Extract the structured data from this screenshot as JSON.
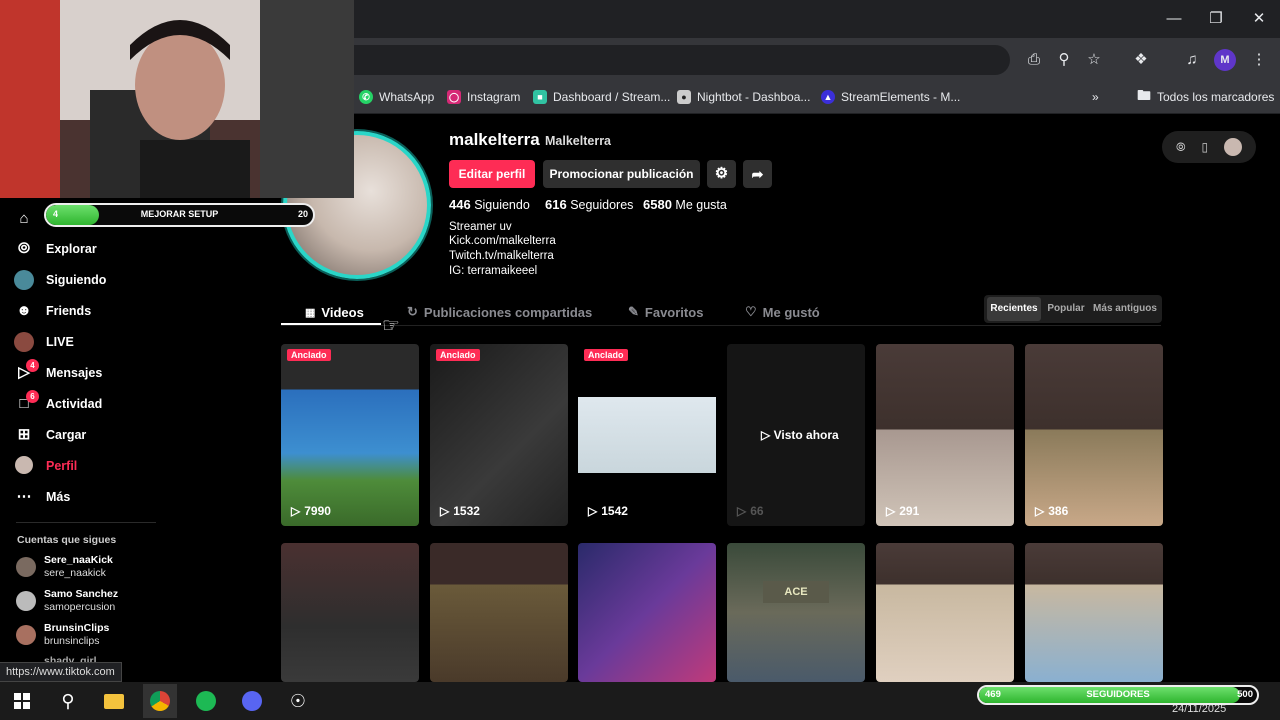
{
  "browser": {
    "bookmarks": [
      {
        "label": "WhatsApp",
        "icon": "whatsapp-icon",
        "color": "#25d366"
      },
      {
        "label": "Instagram",
        "icon": "instagram-icon",
        "color": "#d62976"
      },
      {
        "label": "Dashboard / Stream...",
        "icon": "streamlabs-icon",
        "color": "#31c3a2"
      },
      {
        "label": "Nightbot - Dashboa...",
        "icon": "nightbot-icon",
        "color": "#cccccc"
      },
      {
        "label": "StreamElements - M...",
        "icon": "streamelements-icon",
        "color": "#3b2fd9"
      }
    ],
    "all_bookmarks": "Todos los marcadores",
    "profile_initial": "M",
    "status_url": "https://www.tiktok.com"
  },
  "overlay": {
    "setup": {
      "label": "MEJORAR SETUP",
      "current": "4",
      "goal": "20",
      "progress": 0.2
    },
    "followers": {
      "label": "SEGUIDORES",
      "current": "469",
      "goal": "500",
      "progress": 0.938
    }
  },
  "sidebar": {
    "items": [
      {
        "label": "",
        "icon": "home-icon"
      },
      {
        "label": "Explorar",
        "icon": "compass-icon"
      },
      {
        "label": "Siguiendo",
        "icon": "following-icon"
      },
      {
        "label": "Friends",
        "icon": "friends-icon"
      },
      {
        "label": "LIVE",
        "icon": "live-icon"
      },
      {
        "label": "Mensajes",
        "icon": "messages-icon",
        "badge": "4"
      },
      {
        "label": "Actividad",
        "icon": "activity-icon",
        "badge": "6"
      },
      {
        "label": "Cargar",
        "icon": "upload-icon"
      },
      {
        "label": "Perfil",
        "icon": "profile-icon"
      },
      {
        "label": "Más",
        "icon": "more-icon"
      }
    ],
    "following_header": "Cuentas que sigues",
    "accounts": [
      {
        "name": "Sere_naaKick",
        "user": "sere_naakick"
      },
      {
        "name": "Samo Sanchez",
        "user": "samopercusion"
      },
      {
        "name": "BrunsinClips",
        "user": "brunsinclips"
      },
      {
        "name": "shady_girl",
        "user": ""
      }
    ]
  },
  "profile": {
    "username": "malkelterra",
    "display_name": "Malkelterra",
    "edit_button": "Editar perfil",
    "promote_button": "Promocionar publicación",
    "stats": {
      "following": "446",
      "following_label": "Siguiendo",
      "followers": "616",
      "followers_label": "Seguidores",
      "likes": "6580",
      "likes_label": "Me gusta"
    },
    "bio": [
      "Streamer uv",
      "Kick.com/malkelterra",
      "Twitch.tv/malkelterra",
      "IG: terramaikeeel"
    ],
    "accent_color": "#fe2c55"
  },
  "tabs": [
    "Videos",
    "Publicaciones compartidas",
    "Favoritos",
    "Me gustó"
  ],
  "sort": [
    "Recientes",
    "Popular",
    "Más antiguos"
  ],
  "videos_row1": [
    {
      "views": "7990",
      "pinned": "Anclado"
    },
    {
      "views": "1532",
      "pinned": "Anclado"
    },
    {
      "views": "1542",
      "pinned": "Anclado"
    },
    {
      "views": "66",
      "overlay": "Visto ahora"
    },
    {
      "views": "291"
    },
    {
      "views": "386"
    }
  ],
  "thumb_texts": {
    "ace": "ACE"
  },
  "taskbar": {
    "date": "24/11/2025"
  }
}
